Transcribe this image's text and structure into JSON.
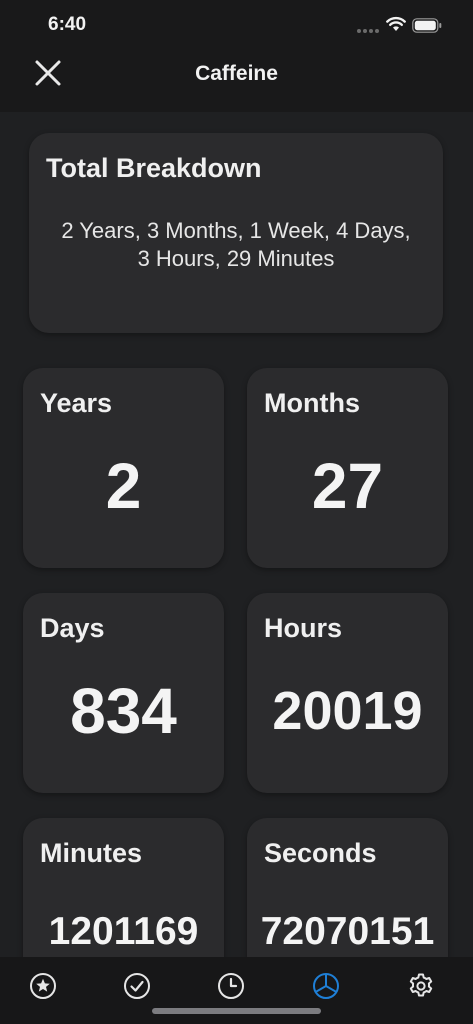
{
  "status_bar": {
    "time": "6:40"
  },
  "nav": {
    "title": "Caffeine",
    "close_icon": "close-icon"
  },
  "breakdown": {
    "title": "Total Breakdown",
    "text": "2 Years, 3 Months, 1 Week, 4 Days, 3 Hours, 29 Minutes"
  },
  "stats": {
    "years": {
      "label": "Years",
      "value": "2"
    },
    "months": {
      "label": "Months",
      "value": "27"
    },
    "days": {
      "label": "Days",
      "value": "834"
    },
    "hours": {
      "label": "Hours",
      "value": "20019"
    },
    "minutes": {
      "label": "Minutes",
      "value": "1201169"
    },
    "seconds": {
      "label": "Seconds",
      "value": "72070151"
    }
  },
  "tabbar": {
    "tabs": [
      {
        "icon": "star-icon",
        "active": false
      },
      {
        "icon": "checkmark-icon",
        "active": false
      },
      {
        "icon": "clock-icon",
        "active": false
      },
      {
        "icon": "pie-chart-icon",
        "active": true
      },
      {
        "icon": "gear-icon",
        "active": false
      }
    ],
    "active_color": "#1f7fd6",
    "inactive_color": "#e6e6e6"
  },
  "colors": {
    "background": "#1f2022",
    "card": "#2b2b2d",
    "header": "#19191a"
  }
}
